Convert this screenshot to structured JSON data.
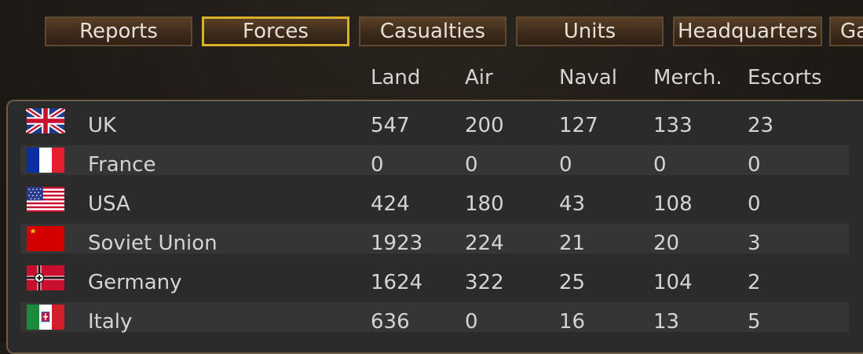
{
  "tabs": [
    {
      "label": "Reports",
      "active": false
    },
    {
      "label": "Forces",
      "active": true
    },
    {
      "label": "Casualties",
      "active": false
    },
    {
      "label": "Units",
      "active": false
    },
    {
      "label": "Headquarters",
      "active": false
    },
    {
      "label": "Ga",
      "active": false
    }
  ],
  "columns": [
    "Land",
    "Air",
    "Naval",
    "Merch.",
    "Escorts"
  ],
  "rows": [
    {
      "flag": "uk-flag-icon",
      "country": "UK",
      "land": "547",
      "air": "200",
      "naval": "127",
      "merch": "133",
      "escorts": "23"
    },
    {
      "flag": "france-flag-icon",
      "country": "France",
      "land": "0",
      "air": "0",
      "naval": "0",
      "merch": "0",
      "escorts": "0"
    },
    {
      "flag": "usa-flag-icon",
      "country": "USA",
      "land": "424",
      "air": "180",
      "naval": "43",
      "merch": "108",
      "escorts": "0"
    },
    {
      "flag": "soviet-flag-icon",
      "country": "Soviet Union",
      "land": "1923",
      "air": "224",
      "naval": "21",
      "merch": "20",
      "escorts": "3"
    },
    {
      "flag": "germany-flag-icon",
      "country": "Germany",
      "land": "1624",
      "air": "322",
      "naval": "25",
      "merch": "104",
      "escorts": "2"
    },
    {
      "flag": "italy-flag-icon",
      "country": "Italy",
      "land": "636",
      "air": "0",
      "naval": "16",
      "merch": "13",
      "escorts": "5"
    }
  ],
  "colors": {
    "active_tab_border": "#d9b02a",
    "tab_fill": "#3d2b1a",
    "row_alt": "#353535",
    "panel": "#2b2b2b"
  }
}
